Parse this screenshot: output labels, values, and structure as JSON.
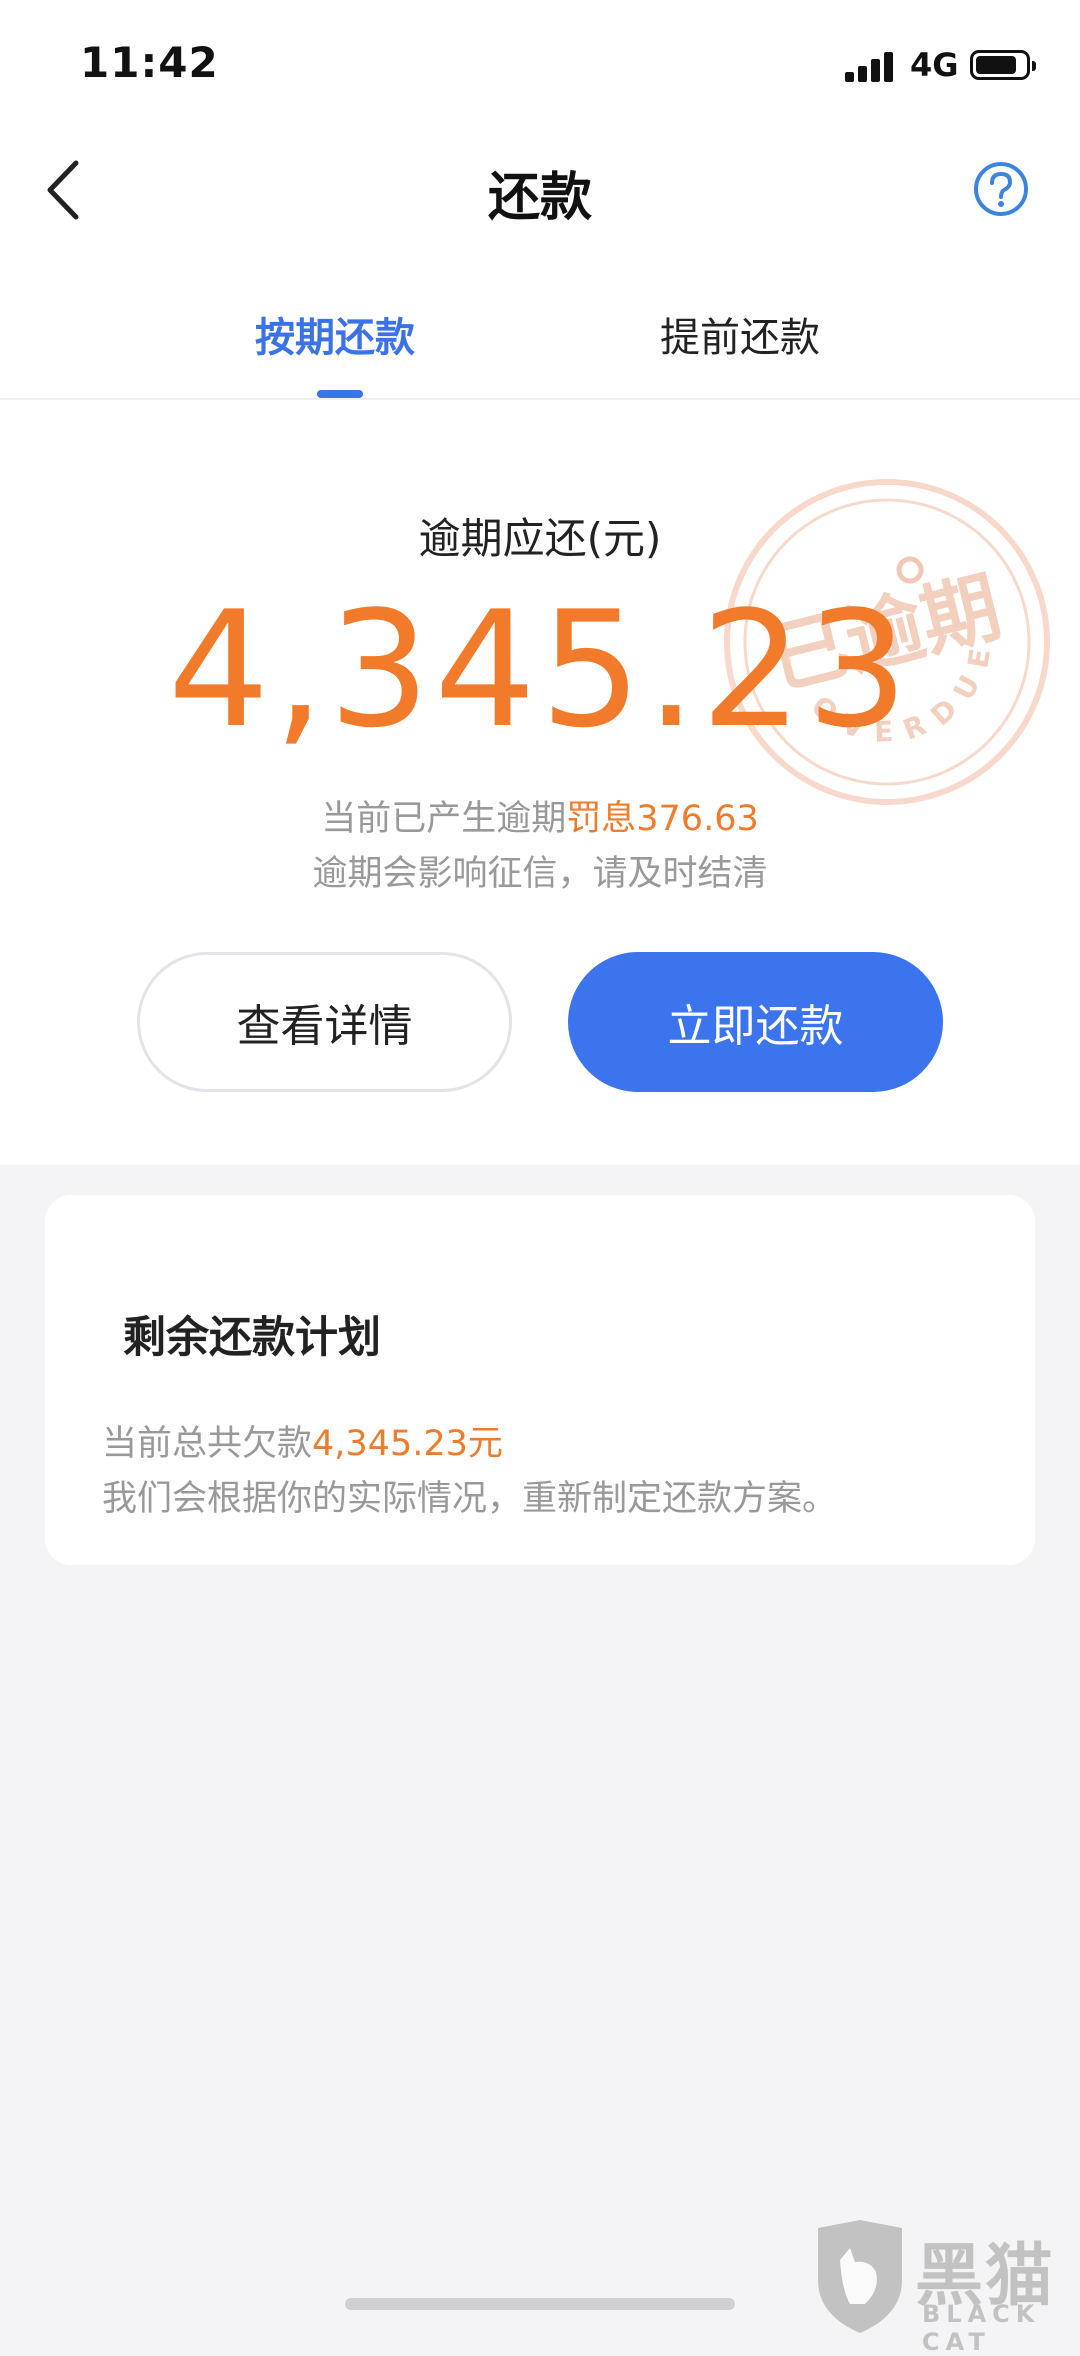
{
  "status_bar": {
    "time": "11:42",
    "network": "4G"
  },
  "nav": {
    "title": "还款"
  },
  "tabs": [
    {
      "label": "按期还款",
      "active": true
    },
    {
      "label": "提前还款",
      "active": false
    }
  ],
  "overdue": {
    "label": "逾期应还(元)",
    "amount": "4,345.23",
    "penalty_prefix": "当前已产生逾期",
    "penalty_highlight": "罚息376.63",
    "warning": "逾期会影响征信，请及时结清"
  },
  "stamp": {
    "text_cn": "已逾期",
    "text_en": "OVERDUE"
  },
  "buttons": {
    "detail": "查看详情",
    "pay": "立即还款"
  },
  "plan": {
    "title": "剩余还款计划",
    "total_prefix": "当前总共欠款",
    "total_amount": "4,345.23元",
    "note": "我们会根据你的实际情况，重新制定还款方案。"
  },
  "watermark": {
    "cn": "黑猫",
    "en": "BLACK CAT"
  },
  "colors": {
    "accent": "#3b72e8",
    "warning": "#f27a2b",
    "background": "#f4f4f6"
  }
}
